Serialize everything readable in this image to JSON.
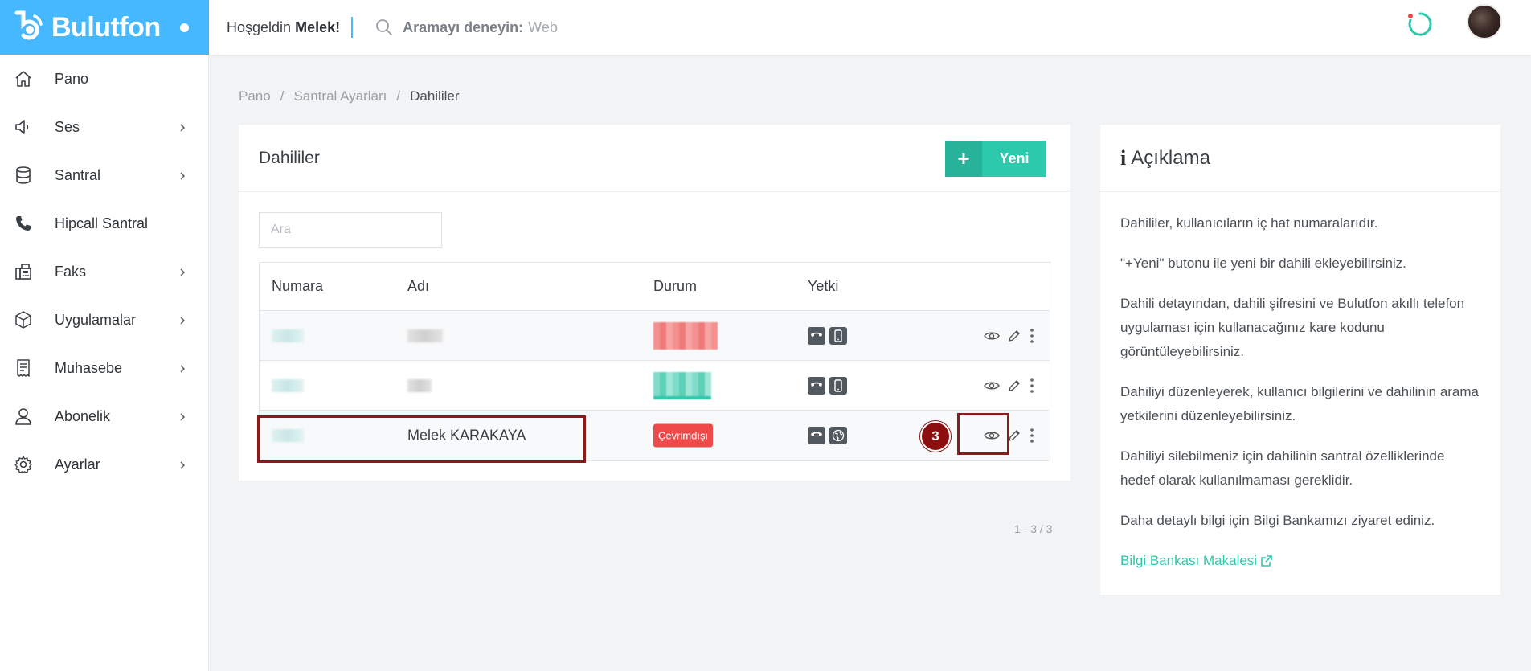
{
  "brand": {
    "name": "Bulutfon"
  },
  "topbar": {
    "greeting_prefix": "Hoşgeldin",
    "user_name": "Melek!",
    "search_label": "Aramayı deneyin:",
    "search_hint": "Web"
  },
  "sidebar": {
    "items": [
      {
        "label": "Pano",
        "icon": "home-icon",
        "has_children": false
      },
      {
        "label": "Ses",
        "icon": "speaker-icon",
        "has_children": true
      },
      {
        "label": "Santral",
        "icon": "database-icon",
        "has_children": true
      },
      {
        "label": "Hipcall Santral",
        "icon": "phone-icon",
        "has_children": false
      },
      {
        "label": "Faks",
        "icon": "fax-icon",
        "has_children": true
      },
      {
        "label": "Uygulamalar",
        "icon": "cube-icon",
        "has_children": true
      },
      {
        "label": "Muhasebe",
        "icon": "receipt-icon",
        "has_children": true
      },
      {
        "label": "Abonelik",
        "icon": "user-icon",
        "has_children": true
      },
      {
        "label": "Ayarlar",
        "icon": "gear-icon",
        "has_children": true
      }
    ]
  },
  "breadcrumb": {
    "items": [
      "Pano",
      "Santral Ayarları",
      "Dahililer"
    ],
    "separator": "/"
  },
  "extensions": {
    "title": "Dahililer",
    "new_button": "Yeni",
    "filter_placeholder": "Ara",
    "columns": {
      "number": "Numara",
      "name": "Adı",
      "status": "Durum",
      "permission": "Yetki"
    },
    "rows": [
      {
        "number": "",
        "name": "",
        "status": "",
        "status_color": "#f07a7a",
        "permissions": [
          "handset-icon",
          "mobile-icon"
        ]
      },
      {
        "number": "",
        "name": "",
        "status": "",
        "status_color": "#2dc9ad",
        "permissions": [
          "handset-icon",
          "mobile-icon"
        ]
      },
      {
        "number": "",
        "name": "Melek KARAKAYA",
        "status": "Çevrimdışı",
        "status_color": "#ee4a4a",
        "permissions": [
          "handset-icon",
          "globe-icon"
        ]
      }
    ],
    "pagination": "1 - 3 / 3"
  },
  "info": {
    "title": "Açıklama",
    "paragraphs": [
      "Dahililer, kullanıcıların iç hat numaralarıdır.",
      "\"+Yeni\" butonu ile yeni bir dahili ekleyebilirsiniz.",
      "Dahili detayından, dahili şifresini ve Bulutfon akıllı telefon uygulaması için kullanacağınız kare kodunu görüntüleyebilirsiniz.",
      "Dahiliyi düzenleyerek, kullanıcı bilgilerini ve dahilinin arama yetkilerini düzenleyebilirsiniz.",
      "Dahiliyi silebilmeniz için dahilinin santral özelliklerinde hedef olarak kullanılmaması gereklidir.",
      "Daha detaylı bilgi için Bilgi Bankamızı ziyaret ediniz."
    ],
    "link": "Bilgi Bankası Makalesi"
  },
  "annotation": {
    "step": "3"
  },
  "colors": {
    "brand": "#46b8ff",
    "accent": "#2dc9ad",
    "danger": "#ee4a4a",
    "annotation": "#8b1a1a"
  }
}
